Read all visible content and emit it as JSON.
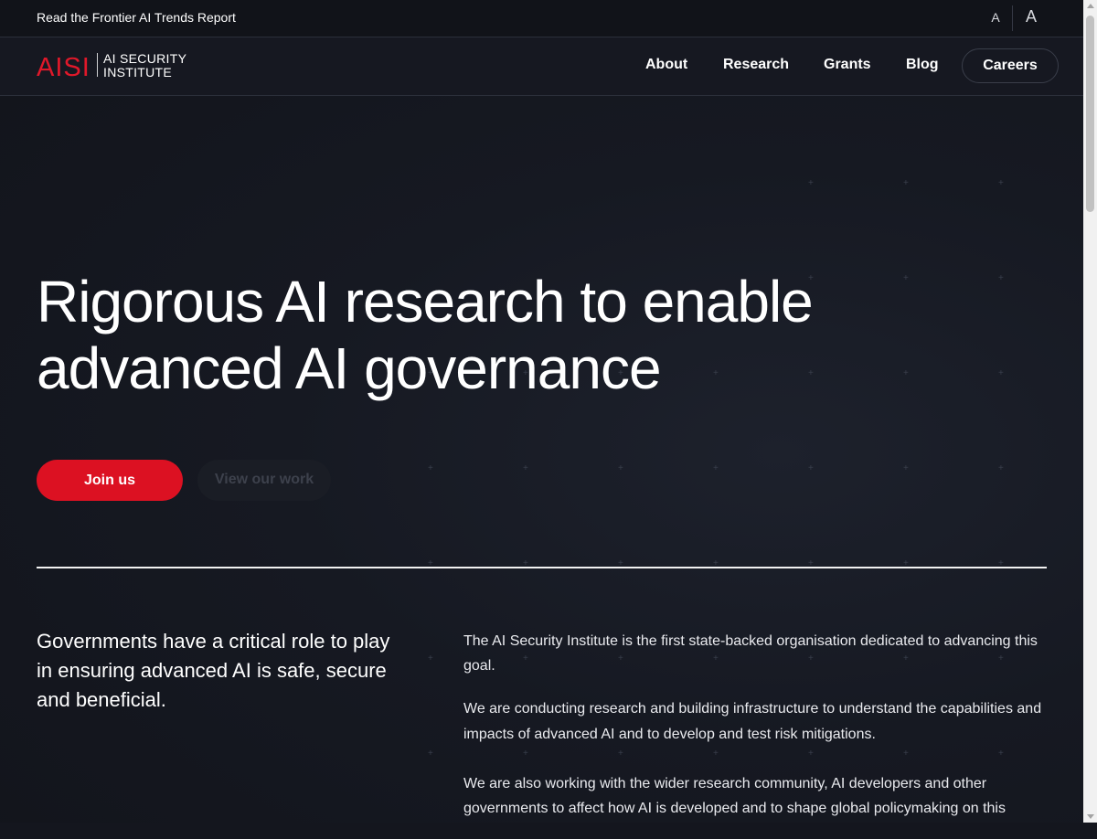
{
  "topbar": {
    "link": "Read the Frontier AI Trends Report",
    "font_small": "A",
    "font_large": "A"
  },
  "nav": {
    "logo_mark": "AISI",
    "logo_line1": "AI SECURITY",
    "logo_line2": "INSTITUTE",
    "items": [
      {
        "label": "About"
      },
      {
        "label": "Research"
      },
      {
        "label": "Grants"
      },
      {
        "label": "Blog"
      }
    ],
    "careers_label": "Careers"
  },
  "hero": {
    "title_line1": "Rigorous AI research to enable",
    "title_line2": "advanced AI governance",
    "primary_label": "Join us",
    "secondary_label": "View our work"
  },
  "about": {
    "lead": "Governments have a critical role to play in ensuring advanced AI is safe, secure and beneficial.",
    "paragraphs": [
      "The AI Security Institute is the first state-backed organisation dedicated to advancing this goal.",
      "We are conducting research and building infrastructure to understand the capabilities and impacts of advanced AI and to develop and test risk mitigations.",
      "We are also working with the wider research community, AI developers and other governments to affect how AI is developed and to shape global policymaking on this"
    ]
  },
  "colors": {
    "accent": "#dc1122",
    "background": "#14161e",
    "text": "#ffffff"
  },
  "icons": {
    "scroll_up": "triangle-up-icon",
    "scroll_down": "triangle-down-icon"
  }
}
